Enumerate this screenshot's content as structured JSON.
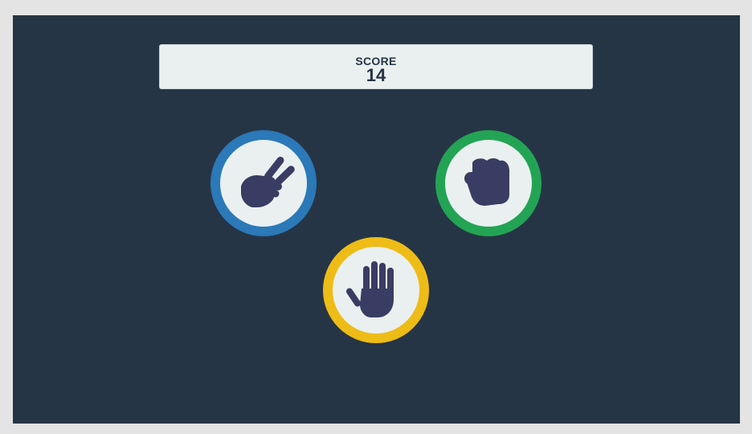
{
  "score": {
    "label": "SCORE",
    "value": "14"
  },
  "choices": [
    {
      "id": "scissors",
      "icon": "scissors-hand-icon",
      "ring_color": "#2b79b8"
    },
    {
      "id": "rock",
      "icon": "rock-fist-icon",
      "ring_color": "#23a455"
    },
    {
      "id": "paper",
      "icon": "paper-hand-icon",
      "ring_color": "#eebc17"
    }
  ],
  "colors": {
    "background": "#263545",
    "panel": "#eaf0f0",
    "hand": "#393d63"
  }
}
